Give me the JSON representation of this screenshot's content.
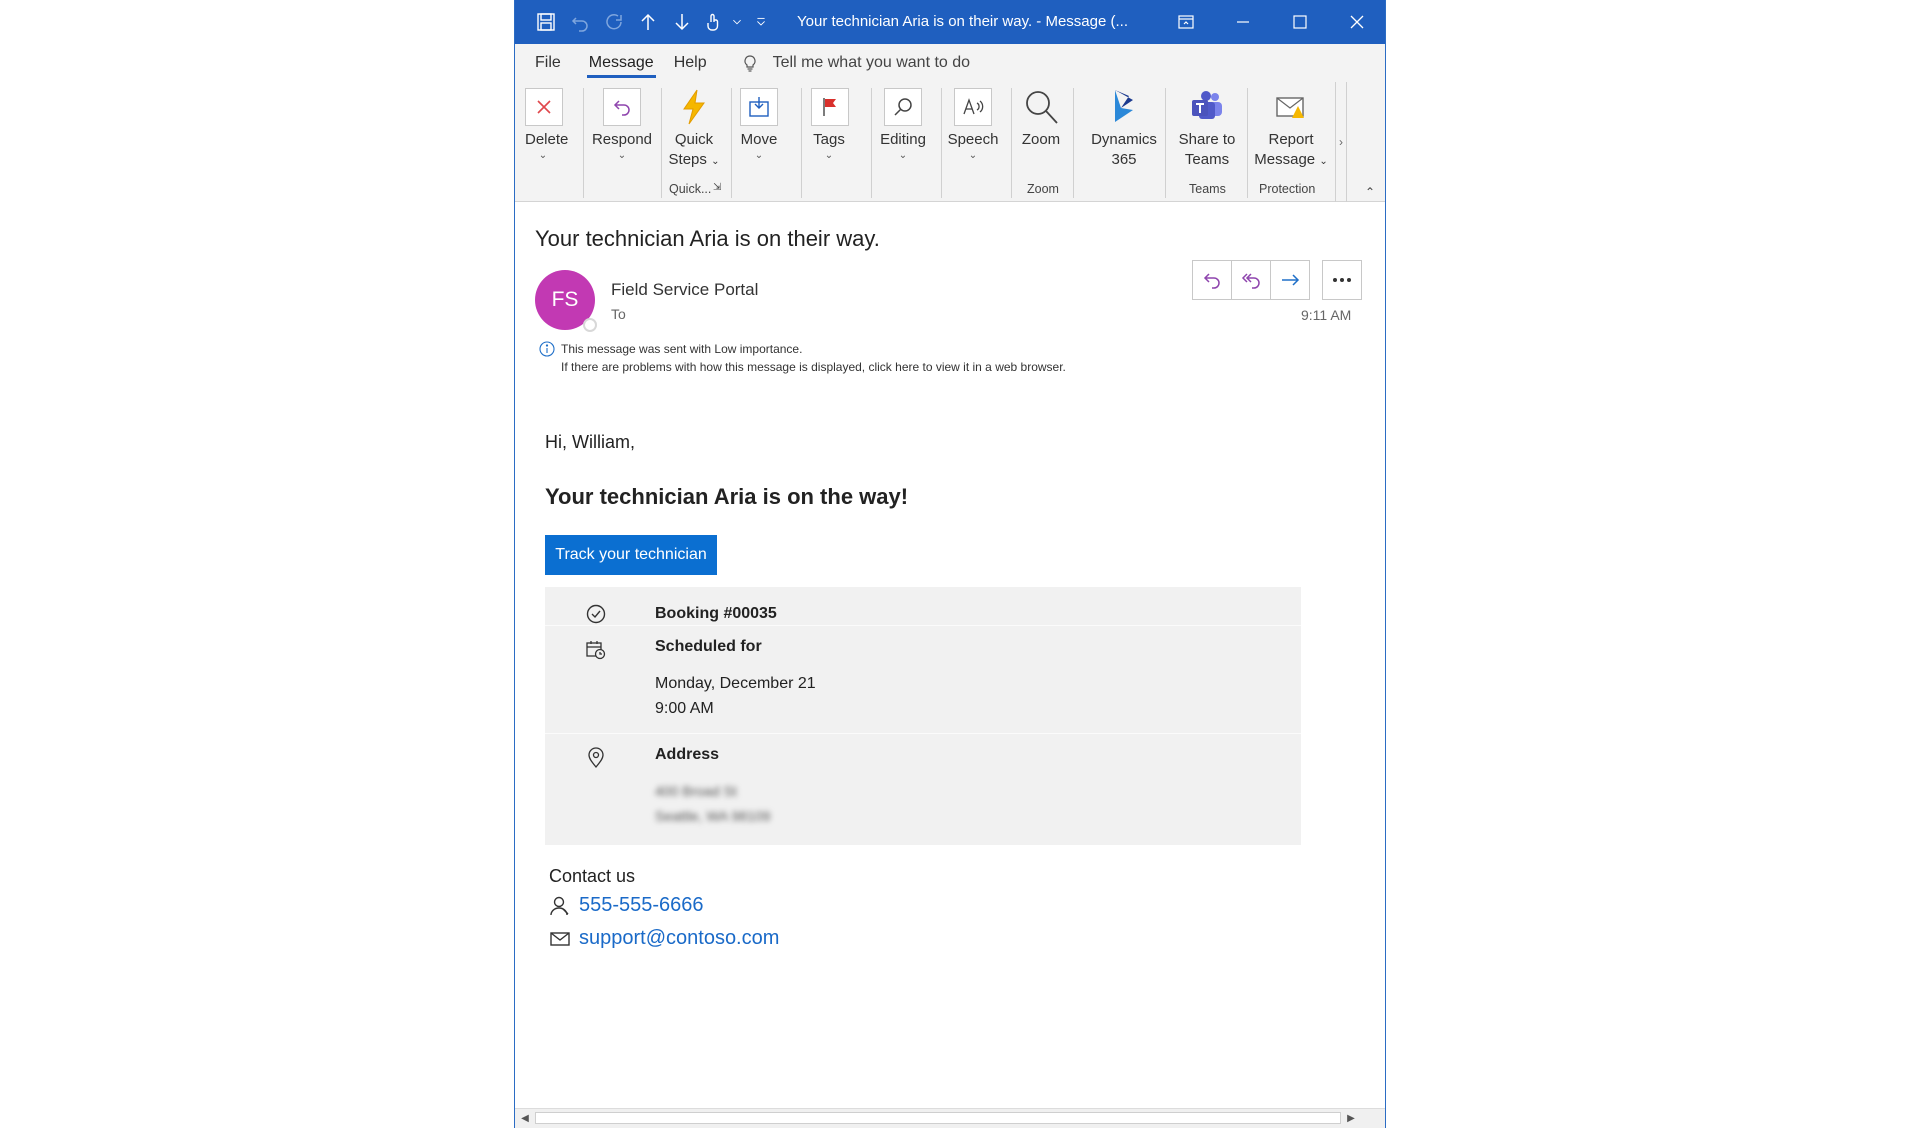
{
  "window": {
    "title": "Your technician Aria is on their way.  -  Message (..."
  },
  "tabs": {
    "file": "File",
    "message": "Message",
    "help": "Help",
    "tell_me": "Tell me what you want to do"
  },
  "ribbon": {
    "delete": "Delete",
    "respond": "Respond",
    "quick_steps_1": "Quick",
    "quick_steps_2": "Steps",
    "move": "Move",
    "tags": "Tags",
    "editing": "Editing",
    "speech": "Speech",
    "zoom": "Zoom",
    "dynamics_1": "Dynamics",
    "dynamics_2": "365",
    "share_teams_1": "Share to",
    "share_teams_2": "Teams",
    "report_1": "Report",
    "report_2": "Message",
    "group_quick": "Quick...",
    "group_zoom": "Zoom",
    "group_teams": "Teams",
    "group_protection": "Protection"
  },
  "message": {
    "subject": "Your technician Aria is on their way.",
    "avatar_initials": "FS",
    "sender": "Field Service Portal",
    "to_label": "To",
    "time": "9:11 AM",
    "info_line1": "This message was sent with Low importance.",
    "info_line2": "If there are problems with how this message is displayed, click here to view it in a web browser."
  },
  "body": {
    "greeting": "Hi, William,",
    "headline": "Your technician Aria is on the way!",
    "track_button": "Track your technician",
    "booking": "Booking #00035",
    "scheduled_label": "Scheduled for",
    "scheduled_date": "Monday, December 21",
    "scheduled_time": "9:00 AM",
    "address_label": "Address",
    "address_line1": "400 Broad St",
    "address_line2": "Seattle, WA 98109",
    "contact_title": "Contact us",
    "phone": "555-555-6666",
    "email": "support@contoso.com"
  },
  "colors": {
    "titlebar": "#1f5fbf",
    "accent": "#0b6fd1",
    "avatar": "#c239b3",
    "link": "#1a6ac8"
  }
}
